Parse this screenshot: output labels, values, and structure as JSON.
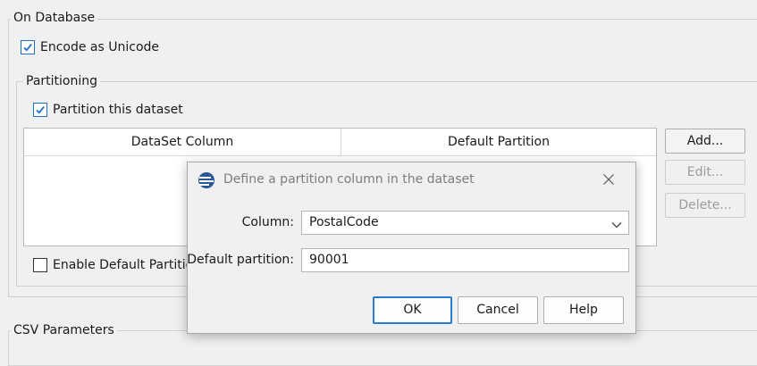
{
  "on_database": {
    "legend": "On Database",
    "encode_unicode": {
      "label": "Encode as Unicode",
      "checked": true
    }
  },
  "partitioning": {
    "legend": "Partitioning",
    "partition_dataset": {
      "label": "Partition this dataset",
      "checked": true
    },
    "table": {
      "columns": [
        "DataSet Column",
        "Default Partition"
      ],
      "rows": []
    },
    "buttons": {
      "add": "Add...",
      "edit": "Edit...",
      "delete": "Delete..."
    },
    "enable_default": {
      "label": "Enable Default Partition",
      "checked": false
    }
  },
  "csv": {
    "legend": "CSV Parameters"
  },
  "dialog": {
    "title": "Define a partition column in the dataset",
    "column_label": "Column:",
    "column_value": "PostalCode",
    "default_partition_label": "Default partition:",
    "default_partition_value": "90001",
    "ok": "OK",
    "cancel": "Cancel",
    "help": "Help"
  }
}
